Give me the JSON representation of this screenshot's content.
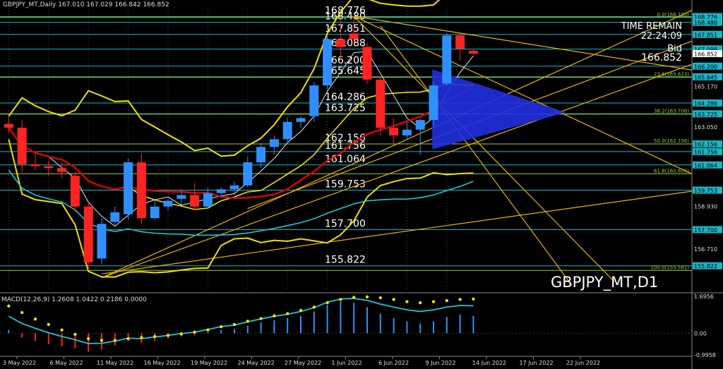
{
  "header": {
    "title": "GBPJPY_MT,Daily  167.010 167.029 166.842 166.852"
  },
  "overlay": {
    "time_remain_label": "TIME REMAIN",
    "time_remain_value": "22:24:09",
    "bid_label": "Bid",
    "bid_value": "166.852",
    "symbol_watermark": "GBPJPY_MT,D1"
  },
  "macd": {
    "title": "MACD(12,26,9) 1.2608 1.0422 0.2186 0.0000",
    "axis_ticks": [
      "1.6956",
      "0.00",
      "-0.9958"
    ]
  },
  "chart_data": {
    "type": "candlestick",
    "title": "GBPJPY_MT,Daily",
    "ylim": [
      154.6,
      169.2
    ],
    "x_labels": [
      "3 May 2022",
      "6 May 2022",
      "11 May 2022",
      "16 May 2022",
      "19 May 2022",
      "24 May 2022",
      "27 May 2022",
      "1 Jun 2022",
      "6 Jun 2022",
      "9 Jun 2022",
      "14 Jun 2022",
      "17 Jun 2022",
      "22 Jun 2022"
    ],
    "price_ticks": [
      "168.776",
      "168.480",
      "167.851",
      "167.098",
      "166.852",
      "166.200",
      "165.645",
      "165.170",
      "164.286",
      "163.725",
      "163.050",
      "162.156",
      "161.756",
      "161.064",
      "159.753",
      "158.930",
      "157.700",
      "156.710",
      "155.822"
    ],
    "level_labels": [
      "168.776",
      "168.480",
      "167.851",
      "167.088",
      "166.200",
      "165.645",
      "164.286",
      "163.725",
      "162.156",
      "161.756",
      "161.064",
      "159.753",
      "157.700",
      "155.822"
    ],
    "fib_labels": [
      "0.0(168.730)",
      "23.6(165.623)",
      "38.2(163.708)",
      "50.0(162.156)",
      "61.8(160.605)",
      "100.0(155.581)"
    ],
    "candles": [
      {
        "o": 163.2,
        "h": 163.6,
        "l": 162.7,
        "c": 163.0
      },
      {
        "o": 163.0,
        "h": 163.4,
        "l": 160.7,
        "c": 161.1
      },
      {
        "o": 161.1,
        "h": 161.7,
        "l": 160.8,
        "c": 161.0
      },
      {
        "o": 161.0,
        "h": 161.3,
        "l": 160.5,
        "c": 160.9
      },
      {
        "o": 160.9,
        "h": 161.2,
        "l": 160.4,
        "c": 160.7
      },
      {
        "o": 160.5,
        "h": 160.7,
        "l": 158.6,
        "c": 158.9
      },
      {
        "o": 158.9,
        "h": 159.2,
        "l": 155.6,
        "c": 156.0
      },
      {
        "o": 156.2,
        "h": 158.3,
        "l": 155.9,
        "c": 158.0
      },
      {
        "o": 158.1,
        "h": 158.9,
        "l": 157.9,
        "c": 158.6
      },
      {
        "o": 158.5,
        "h": 161.4,
        "l": 158.2,
        "c": 161.2
      },
      {
        "o": 161.2,
        "h": 161.7,
        "l": 158.0,
        "c": 158.3
      },
      {
        "o": 158.3,
        "h": 159.2,
        "l": 158.2,
        "c": 158.9
      },
      {
        "o": 158.9,
        "h": 159.3,
        "l": 158.7,
        "c": 159.2
      },
      {
        "o": 159.3,
        "h": 159.8,
        "l": 159.0,
        "c": 159.5
      },
      {
        "o": 159.5,
        "h": 160.1,
        "l": 158.7,
        "c": 158.9
      },
      {
        "o": 158.9,
        "h": 159.9,
        "l": 158.8,
        "c": 159.6
      },
      {
        "o": 159.6,
        "h": 159.9,
        "l": 159.4,
        "c": 159.8
      },
      {
        "o": 159.8,
        "h": 160.2,
        "l": 159.5,
        "c": 160.0
      },
      {
        "o": 160.0,
        "h": 161.5,
        "l": 159.9,
        "c": 161.2
      },
      {
        "o": 161.2,
        "h": 162.2,
        "l": 160.9,
        "c": 162.0
      },
      {
        "o": 162.0,
        "h": 162.6,
        "l": 161.6,
        "c": 162.4
      },
      {
        "o": 162.4,
        "h": 163.5,
        "l": 162.2,
        "c": 163.3
      },
      {
        "o": 163.3,
        "h": 163.6,
        "l": 163.0,
        "c": 163.5
      },
      {
        "o": 163.6,
        "h": 165.4,
        "l": 163.3,
        "c": 165.2
      },
      {
        "o": 165.2,
        "h": 167.8,
        "l": 165.0,
        "c": 167.6
      },
      {
        "o": 167.6,
        "h": 168.6,
        "l": 166.5,
        "c": 167.2
      },
      {
        "o": 167.9,
        "h": 168.8,
        "l": 167.4,
        "c": 167.6
      },
      {
        "o": 167.2,
        "h": 167.4,
        "l": 165.3,
        "c": 165.5
      },
      {
        "o": 165.5,
        "h": 165.6,
        "l": 162.6,
        "c": 163.0
      },
      {
        "o": 163.0,
        "h": 163.5,
        "l": 162.1,
        "c": 162.6
      },
      {
        "o": 162.6,
        "h": 163.3,
        "l": 162.4,
        "c": 162.9
      },
      {
        "o": 162.9,
        "h": 163.5,
        "l": 161.6,
        "c": 163.4
      },
      {
        "o": 163.4,
        "h": 165.4,
        "l": 163.1,
        "c": 165.2
      },
      {
        "o": 165.3,
        "h": 167.9,
        "l": 165.2,
        "c": 167.8
      },
      {
        "o": 167.8,
        "h": 167.9,
        "l": 166.5,
        "c": 167.1
      },
      {
        "o": 167.0,
        "h": 167.1,
        "l": 166.8,
        "c": 166.852
      }
    ],
    "macd_hist": [
      0.15,
      -0.2,
      -0.35,
      -0.5,
      -0.6,
      -0.7,
      -0.85,
      -0.75,
      -0.55,
      -0.35,
      -0.45,
      -0.35,
      -0.25,
      -0.15,
      -0.1,
      0.05,
      0.15,
      0.2,
      0.35,
      0.5,
      0.6,
      0.7,
      0.8,
      1.0,
      1.3,
      1.45,
      1.4,
      1.2,
      0.9,
      0.7,
      0.55,
      0.45,
      0.55,
      0.75,
      0.85,
      0.8
    ],
    "macd_signal": [
      0.9,
      0.6,
      0.3,
      0.05,
      -0.2,
      -0.4,
      -0.6,
      -0.68,
      -0.68,
      -0.6,
      -0.55,
      -0.5,
      -0.45,
      -0.38,
      -0.3,
      -0.2,
      -0.05,
      0.05,
      0.2,
      0.32,
      0.45,
      0.55,
      0.7,
      0.85,
      1.05,
      1.2,
      1.3,
      1.32,
      1.28,
      1.2,
      1.1,
      1.05,
      1.1,
      1.15,
      1.2,
      1.22
    ]
  }
}
